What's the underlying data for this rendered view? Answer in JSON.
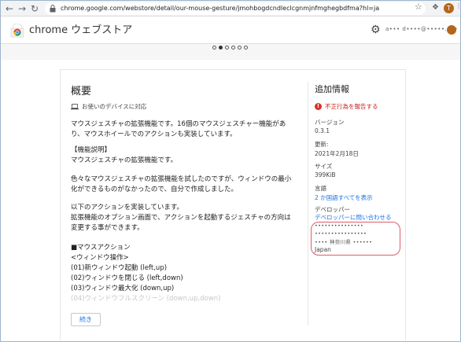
{
  "browser": {
    "url": "chrome.google.com/webstore/detail/our-mouse-gesture/jmohbogdcndleclcgnmjnfmghegbdfma?hl=ja",
    "profile_initial": "T"
  },
  "store": {
    "title": "chrome ウェブストア",
    "account_email": "a••• d••••@•••••.•••"
  },
  "carousel": {
    "dots": 6,
    "active_index": 1
  },
  "overview": {
    "title": "概要",
    "device_text": "お使いのデバイスに対応",
    "lines": [
      "マウスジェスチャの拡張機能です。16個のマウスジェスチャー機能があ",
      "り、マウスホイールでのアクションも実装しています。",
      "",
      "【機能説明】",
      "マウスジェスチャの拡張機能です。",
      "",
      "色々なマウスジェスチャの拡張機能を試したのですが、ウィンドウの最小",
      "化ができるものがなかったので、自分で作成しました。",
      "",
      "以下のアクションを実装しています。",
      "拡張機能のオプション画面で、アクションを起動するジェスチャの方向は",
      "変更する事ができます。",
      "",
      "■マウスアクション",
      "<ウィンドウ操作>",
      " (01)新ウィンドウ起動 (left,up)",
      " (02)ウィンドウを閉じる (left,down)",
      " (03)ウィンドウ最大化 (down,up)",
      " (04)ウィンドウフルスクリーン (down,up,down)"
    ],
    "continue_label": "続き"
  },
  "sidebar": {
    "title": "追加情報",
    "report_label": "不正行為を報告する",
    "version_label": "バージョン",
    "version_value": "0.3.1",
    "updated_label": "更新:",
    "updated_value": "2021年2月18日",
    "size_label": "サイズ",
    "size_value": "399KiB",
    "language_label": "言語",
    "language_link": "2 か国語すべてを表示",
    "developer_label": "デベロッパー",
    "developer_contact_link": "デベロッパーに問い合わせる",
    "address_line1": "•••••••••••••••",
    "address_line2": "••••••••••••••••",
    "address_line3": "•••• 神奈川県 ••••••",
    "country": "Japan",
    "highlight_color": "#e05a6a"
  }
}
